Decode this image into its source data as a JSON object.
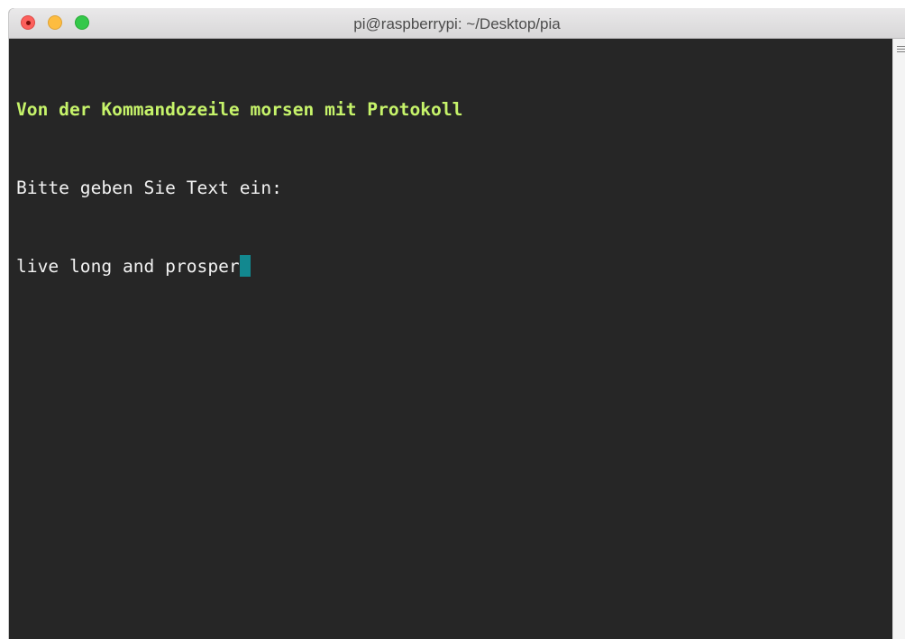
{
  "window": {
    "title": "pi@raspberrypi: ~/Desktop/pia"
  },
  "terminal": {
    "lines": [
      "Von der Kommandozeile morsen mit Protokoll",
      "Bitte geben Sie Text ein:",
      "live long and prosper"
    ]
  },
  "colors": {
    "background": "#262626",
    "header_text": "#c6f36a",
    "text": "#f2f2f2",
    "cursor": "#12888f"
  },
  "icons": {
    "close": "close-icon",
    "minimize": "minimize-icon",
    "zoom": "zoom-icon",
    "scroll_grip": "scroll-grip-icon"
  }
}
